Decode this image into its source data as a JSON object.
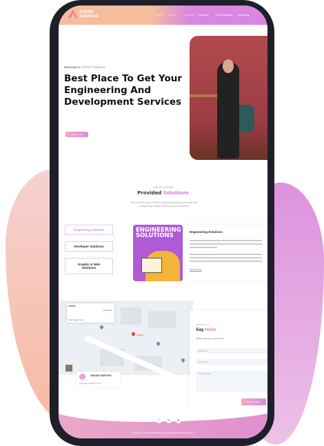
{
  "nav": {
    "logo_top": "ATERO",
    "logo_bottom": "Solutions",
    "items": [
      "Home",
      "About",
      "Services",
      "Portfolio",
      "Our Solutions",
      "About Us"
    ]
  },
  "hero": {
    "welcome": "Welcome to",
    "brand": "ATERO Solutions",
    "title": "Best Place To Get Your Engineering And Development Services",
    "button": "Learn more"
  },
  "solutions": {
    "eyebrow": "OUR SOLUTIONS",
    "title_a": "Provided",
    "title_b": "Solutions",
    "desc_a": "You can think about",
    "desc_brand": "ATERO Solutions",
    "desc_b": "whenever you need any engineering, design services for your business",
    "tabs": [
      "Engineering Solutions",
      "Developer Solutions",
      "Graphic & Web Solutions"
    ],
    "image_title": "ENGINEERING SOLUTIONS",
    "card_title": "Engineering Solutions",
    "read_more": "Read More"
  },
  "map": {
    "place": "ATERO",
    "address": "Directions",
    "view_larger": "View larger map",
    "pin_label": "ATERO"
  },
  "support": {
    "title": "ONLINE SUPPORT",
    "email": "info@aterosolutions.com"
  },
  "contact": {
    "eyebrow": "CONTACT US",
    "title_a": "Say",
    "title_b": "Hello",
    "desc": "Please leave your inquiry here",
    "name": "Full Name",
    "email": "Your Email",
    "message": "Your Message",
    "submit": "Send Message"
  },
  "footer": {
    "social": [
      "f",
      "in",
      "▶"
    ],
    "copyright": "Copyright © 2024 ATERO Solutions | Created by ATERO Solutions"
  }
}
